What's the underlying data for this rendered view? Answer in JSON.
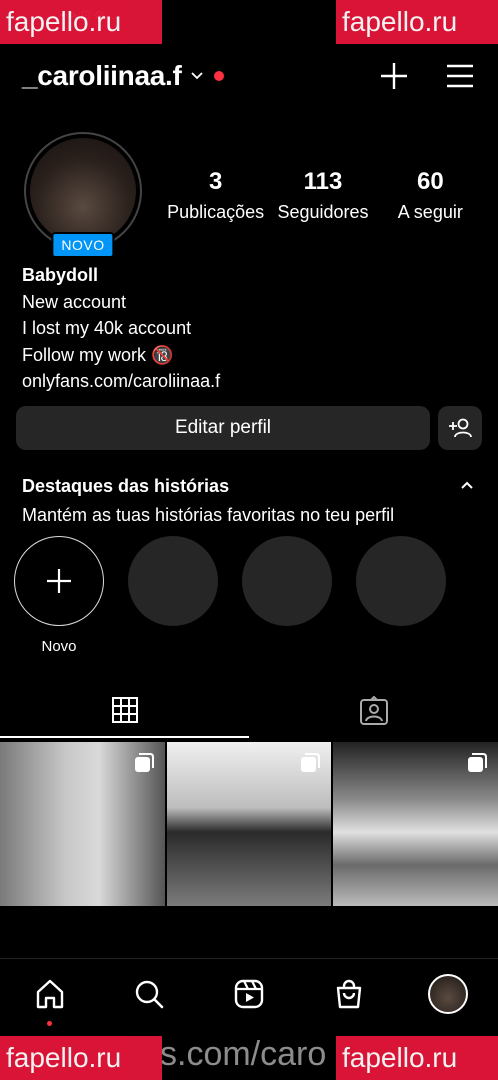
{
  "status_bar": {
    "text": "• ⊳ ⊡ ⊙ ..."
  },
  "watermarks": {
    "tl": "fapello.ru",
    "tr": "fapello.ru",
    "bl": "fapello.ru",
    "br": "fapello.ru",
    "url": "s.com/caro"
  },
  "header": {
    "username": "_caroliinaa.f",
    "icons": [
      "chevron-down-icon",
      "notification-dot",
      "plus-icon",
      "menu-icon"
    ]
  },
  "profile": {
    "badge": "NOVO",
    "stats": [
      {
        "value": "3",
        "label": "Publicações"
      },
      {
        "value": "113",
        "label": "Seguidores"
      },
      {
        "value": "60",
        "label": "A seguir"
      }
    ],
    "bio": {
      "name": "Babydoll",
      "lines": [
        "New account",
        "I lost my 40k account",
        "Follow my work 🔞"
      ],
      "link": "onlyfans.com/caroliinaa.f"
    }
  },
  "actions": {
    "edit_label": "Editar perfil"
  },
  "highlights": {
    "title": "Destaques das histórias",
    "subtitle": "Mantém as tuas histórias favoritas no teu perfil",
    "new_label": "Novo"
  },
  "tabs": [
    "grid-icon",
    "tagged-icon"
  ],
  "nav": [
    "home-icon",
    "search-icon",
    "reels-icon",
    "shop-icon",
    "profile-avatar"
  ],
  "colors": {
    "accent": "#0095f6",
    "notification": "#ff3040",
    "button_bg": "#262626"
  }
}
